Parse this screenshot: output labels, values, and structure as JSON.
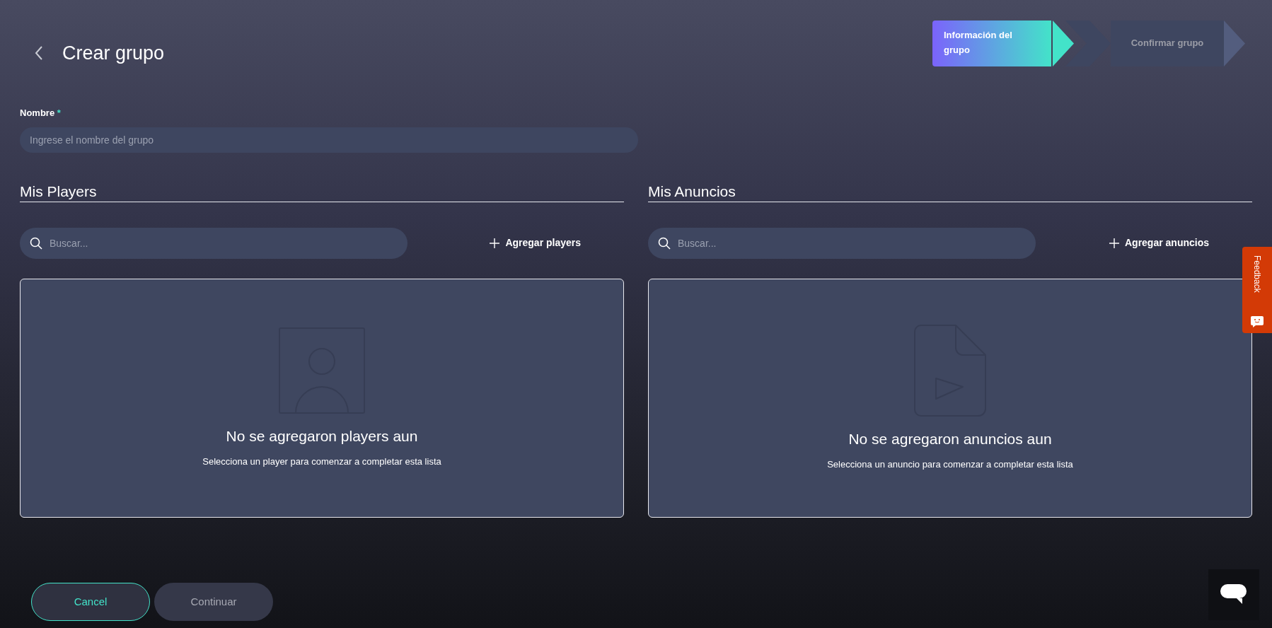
{
  "header": {
    "title": "Crear grupo"
  },
  "steps": [
    {
      "label": "Información del grupo",
      "selected": true
    },
    {
      "label": "Confirmar grupo",
      "selected": false
    }
  ],
  "name_field": {
    "label": "Nombre",
    "required_mark": "*",
    "placeholder": "Ingrese el nombre del grupo"
  },
  "panels": [
    {
      "kind": "players",
      "title": "Mis Players",
      "search_placeholder": "Buscar...",
      "add_label": "Agregar players",
      "empty_title": "No se agregaron players aun",
      "empty_text": "Selecciona un player para comenzar a completar esta lista"
    },
    {
      "kind": "ads",
      "title": "Mis Anuncios",
      "search_placeholder": "Buscar...",
      "add_label": "Agregar anuncios",
      "empty_title": "No se agregaron anuncios aun",
      "empty_text": "Selecciona un anuncio para comenzar a completar esta lista"
    }
  ],
  "buttons": [
    {
      "label": "Cancel",
      "kind": "outline"
    },
    {
      "label": "Continuar",
      "kind": "filled"
    }
  ],
  "feedback_tab": {
    "label": "Feedback"
  }
}
